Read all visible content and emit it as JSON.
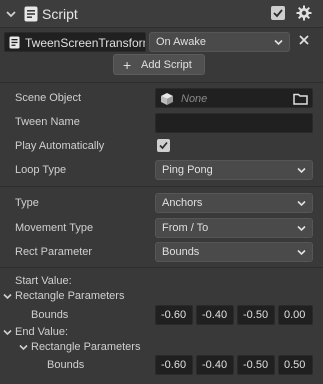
{
  "header": {
    "title": "Script"
  },
  "script_row": {
    "script_name": "TweenScreenTransform",
    "event_value": "On Awake"
  },
  "add_script_label": "Add Script",
  "fields": {
    "scene_object_label": "Scene Object",
    "scene_object_value": "None",
    "tween_name_label": "Tween Name",
    "tween_name_value": "",
    "play_auto_label": "Play Automatically",
    "play_auto_checked": true,
    "loop_type_label": "Loop Type",
    "loop_type_value": "Ping Pong",
    "type_label": "Type",
    "type_value": "Anchors",
    "movement_label": "Movement Type",
    "movement_value": "From / To",
    "rect_param_label": "Rect Parameter",
    "rect_param_value": "Bounds"
  },
  "start_value": {
    "label": "Start Value:",
    "group_label": "Rectangle Parameters",
    "bounds_label": "Bounds",
    "bounds": [
      "-0.60",
      "-0.40",
      "-0.50",
      "0.00"
    ]
  },
  "end_value": {
    "label": "End Value:",
    "group_label": "Rectangle Parameters",
    "bounds_label": "Bounds",
    "bounds": [
      "-0.60",
      "-0.40",
      "-0.50",
      "0.50"
    ]
  },
  "colors": {
    "panel_bg": "#393939",
    "field_bg": "#202020",
    "dropdown_bg": "#4a4a4a",
    "text": "#d7d7d7"
  }
}
